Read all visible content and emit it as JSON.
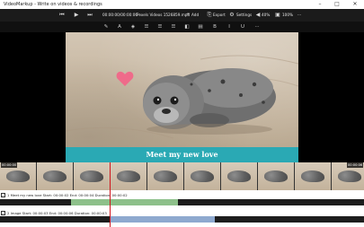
{
  "window": {
    "title": "VideoMarkup - Write on videos & recordings",
    "minimize_glyph": "–",
    "maximize_glyph": "□",
    "close_glyph": "✕"
  },
  "toolbar": {
    "time_display": "00:00:00/00:00:06",
    "file_name": "Pexels Videos 1526859.mp4",
    "add_label": "Add",
    "export_label": "Export",
    "settings_label": "Settings",
    "volume_label": "40%",
    "zoom_label": "100%",
    "more_glyph": "···"
  },
  "format_toolbar": {
    "icons": [
      "pen-icon",
      "text-size-icon",
      "color-fill-icon",
      "align-left-icon",
      "align-center-icon",
      "align-justify-icon",
      "align-right-icon",
      "contrast-icon",
      "layers-icon",
      "bold-icon",
      "italic-icon",
      "underline-icon",
      "more-icon"
    ],
    "bold_glyph": "B",
    "italic_glyph": "I",
    "underline_glyph": "U",
    "more_glyph": "···"
  },
  "video": {
    "caption": "Meet my new love",
    "caption_bg": "#2aa9b4",
    "heart_color": "#ef6b8a"
  },
  "filmstrip": {
    "start_timecode": "00:00:00",
    "end_timecode": "00:00:06",
    "playhead_color": "#d0141c"
  },
  "tracks": [
    {
      "label": "1 Meet my new love   Start: 00:00:02      End: 00:00:04      Duration: 00:00:02",
      "color": "#8dc08a"
    },
    {
      "label": "2 Image   Start: 00:00:03      End: 00:00:06      Duration: 00:00:03",
      "color": "#8ea9cf"
    }
  ]
}
